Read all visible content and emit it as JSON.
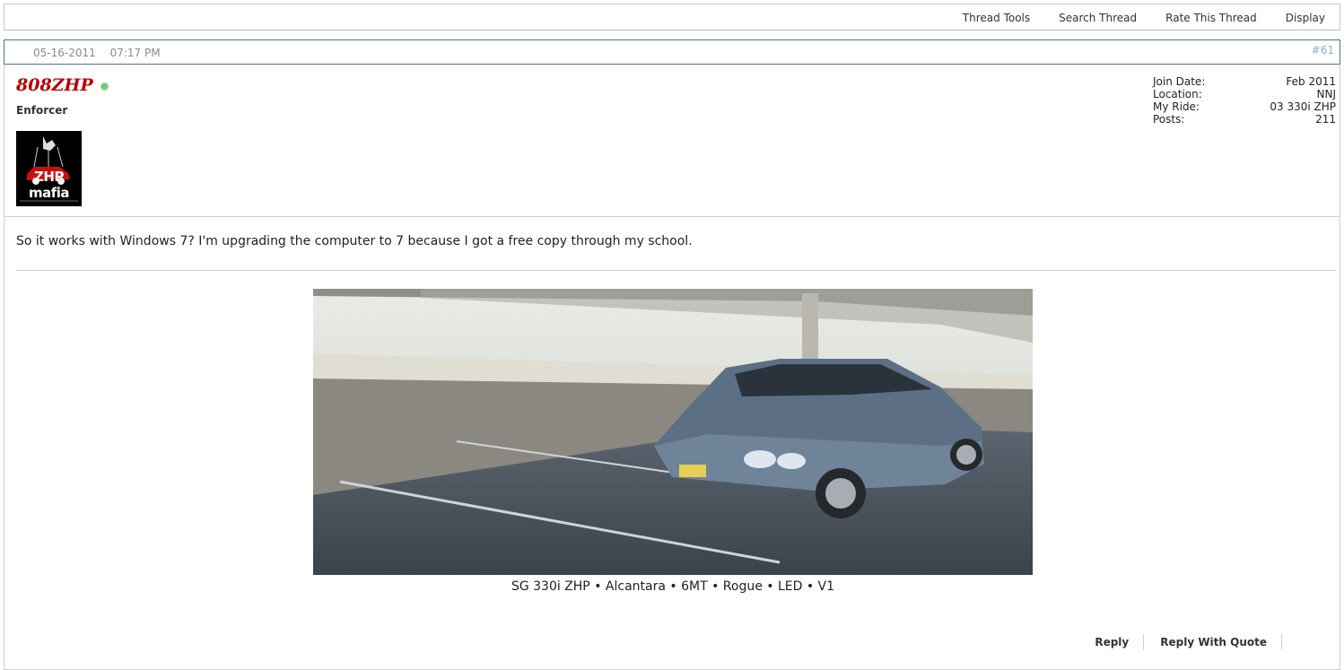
{
  "toolbar": {
    "items": [
      "Thread Tools",
      "Search Thread",
      "Rate This Thread",
      "Display"
    ]
  },
  "post": {
    "date": "05-16-2011",
    "time": "07:17 PM",
    "number": "#61",
    "username": "808ZHP",
    "user_title": "Enforcer",
    "avatar_text": "ZHP mafia",
    "stats": [
      {
        "label": "Join Date:",
        "value": "Feb 2011"
      },
      {
        "label": "Location:",
        "value": "NNJ"
      },
      {
        "label": "My Ride:",
        "value": "03 330i ZHP"
      },
      {
        "label": "Posts:",
        "value": "211"
      }
    ],
    "message": "So it works with Windows 7? I'm upgrading the computer to 7 because I got a free copy through my school.",
    "signature": "SG 330i ZHP • Alcantara • 6MT • Rogue • LED • V1"
  },
  "actions": {
    "reply": "Reply",
    "reply_quote": "Reply With Quote"
  },
  "colors": {
    "username": "#b80000",
    "header_border": "#4a7690",
    "post_number": "#8ab0c8"
  }
}
